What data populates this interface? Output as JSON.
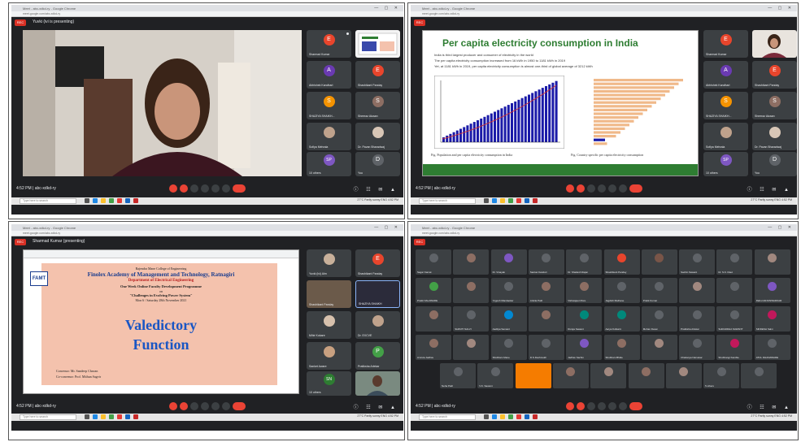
{
  "q1": {
    "browser_title": "Meet - abc-xdkd-ry - Google Chrome",
    "url": "meet.google.com/abc-xdkd-ry",
    "presenting_text": "Yuvki (ivi is presenting)",
    "time": "4:52 PM | abc-xdkd-ry",
    "participants": [
      {
        "label": "Sharmad Kumar",
        "initial": "E",
        "color": "#e8452c"
      },
      {
        "label": "",
        "initial": "",
        "color": ""
      },
      {
        "label": "Abhishek Kandhari",
        "initial": "A",
        "color": "#6a3ab2"
      },
      {
        "label": "Shashikant Panday",
        "initial": "E",
        "color": "#e8452c"
      },
      {
        "label": "SHAZIYA SHAIKH...",
        "initial": "S",
        "color": "#f59300"
      },
      {
        "label": "Sheeraz Aizaan",
        "initial": "S",
        "color": "#8d6e63"
      },
      {
        "label": "Sofiya Mehrala",
        "initial": "",
        "color": ""
      },
      {
        "label": "Dr. Pavan Bharadwaj",
        "initial": "",
        "color": ""
      },
      {
        "label": "10 others",
        "initial": "SP",
        "color": "#7e57c2"
      },
      {
        "label": "You",
        "initial": "D",
        "color": "#5f6368"
      }
    ]
  },
  "q2": {
    "browser_title": "Meet - abc-xdkd-ry - Google Chrome",
    "url": "meet.google.com/abc-xdkd-ry",
    "slide_title": "Per capita electricity consumption in India",
    "bullets": [
      "India is third largest producer and consumer of electricity in the world",
      "The per capita electricity consumption increased from 16 kWh in 1950 to 1181 kWh in 2019",
      "Yet, at 1181 kWh in 2019, per capita electricity consumption is almost one-third of global average of 3212 kWh"
    ],
    "caption_left": "Fig. Population and per capita electricity consumption in India",
    "caption_right": "Fig. Country specific per capita electricity consumption",
    "time": "4:52 PM | abc-xdkd-ry",
    "participants": [
      {
        "label": "Sharmad Kumar",
        "initial": "E",
        "color": "#e8452c"
      },
      {
        "label": "",
        "initial": "",
        "color": ""
      },
      {
        "label": "Abhishek Kandhari",
        "initial": "A",
        "color": "#6a3ab2"
      },
      {
        "label": "Shashikant Panday",
        "initial": "E",
        "color": "#e8452c"
      },
      {
        "label": "SHAZIYA SHAIKH...",
        "initial": "S",
        "color": "#f59300"
      },
      {
        "label": "Sheeraz Aizaan",
        "initial": "S",
        "color": "#8d6e63"
      },
      {
        "label": "Sofiya Mehrala",
        "initial": "",
        "color": ""
      },
      {
        "label": "Dr. Pavan Bharadwaj",
        "initial": "",
        "color": ""
      },
      {
        "label": "10 others",
        "initial": "SP",
        "color": "#7e57c2"
      },
      {
        "label": "You",
        "initial": "D",
        "color": "#5f6368"
      }
    ]
  },
  "q3": {
    "browser_title": "Meet - abc-xdkd-ry - Google Chrome",
    "url": "meet.google.com/abc-xdkd-ry",
    "presenting_text": "Sharmad Kumar (presenting)",
    "institute_line1": "Rajendra Mane College of Engineering",
    "institute_line2": "Finolex Academy of Management and Technology, Ratnagiri",
    "dept": "Department of Electrical Engineering",
    "program": "One Week Online Faculty Development Programme",
    "on": "on",
    "topic": "\"Challenges in Evolving Power System\"",
    "dates": "Mon 6 / Saturday 28th November 2021",
    "big1": "Valedictory",
    "big2": "Function",
    "foot1": "Convenor: Mr. Sandeep Chavan",
    "foot2": "Co-convenor: Prof. Mithun Sagvir",
    "logo": "FAMT",
    "time": "4:52 PM | abc-xdkd-ry",
    "participants": [
      {
        "label": "Yuvki (ivi) Alm",
        "initial": "",
        "color": ""
      },
      {
        "label": "Shashikant Panday",
        "initial": "E",
        "color": "#e8452c"
      },
      {
        "label": "Shashikant Panday",
        "initial": "",
        "color": ""
      },
      {
        "label": "SHAZIYA SHAIKH",
        "initial": "",
        "color": ""
      },
      {
        "label": "Mihir Kokare",
        "initial": "",
        "color": ""
      },
      {
        "label": "Dr. EXCVE",
        "initial": "",
        "color": ""
      },
      {
        "label": "Sanket Aware",
        "initial": "",
        "color": ""
      },
      {
        "label": "Pratiksha Arlekar",
        "initial": "P",
        "color": "#43a047"
      },
      {
        "label": "10 others",
        "initial": "SN",
        "color": "#2e7d32"
      },
      {
        "label": "",
        "initial": "",
        "color": ""
      }
    ]
  },
  "q4": {
    "browser_title": "Meet - abc-xdkd-ry - Google Chrome",
    "url": "meet.google.com/abc-xdkd-ry",
    "time": "4:52 PM | abc-xdkd-ry",
    "tiles": [
      {
        "label": "Sagar Kamat",
        "color": "#5f6368"
      },
      {
        "label": "",
        "color": "#8d6e63"
      },
      {
        "label": "Dr. Vinayak",
        "color": "#7e57c2"
      },
      {
        "label": "Sanket Kanduri",
        "color": "#5f6368"
      },
      {
        "label": "Dr. Shailesh Rajan",
        "color": "#5f6368"
      },
      {
        "label": "Shashikant Panday",
        "color": "#e8452c"
      },
      {
        "label": "",
        "color": "#795548"
      },
      {
        "label": "Sachin Sawant",
        "color": "#5f6368"
      },
      {
        "label": "Dr. S.K. Raut",
        "color": "#5f6368"
      },
      {
        "label": "",
        "color": "#a1887f"
      },
      {
        "label": "Pratik NALAWADE",
        "color": "#43a047"
      },
      {
        "label": "",
        "color": "#8d6e63"
      },
      {
        "label": "Yogesh Mandaokar",
        "color": "#5f6368"
      },
      {
        "label": "Ankita Patil",
        "color": "#8d6e63"
      },
      {
        "label": "Vishwajeet More",
        "color": "#8d6e63"
      },
      {
        "label": "Jagdish Mathane",
        "color": "#5f6368"
      },
      {
        "label": "Pratik Kumar",
        "color": "#5f6368"
      },
      {
        "label": "",
        "color": "#a1887f"
      },
      {
        "label": "",
        "color": "#5f6368"
      },
      {
        "label": "Rahul ARJUNWADKAR",
        "color": "#7e57c2"
      },
      {
        "label": "",
        "color": "#8d6e63"
      },
      {
        "label": "SHRUTI SALVI",
        "color": "#5f6368"
      },
      {
        "label": "Aaditya Samant",
        "color": "#0288d1"
      },
      {
        "label": "",
        "color": "#8d6e63"
      },
      {
        "label": "Rutuja Sawant",
        "color": "#00897b"
      },
      {
        "label": "Aarya Kulkarni",
        "color": "#00897b"
      },
      {
        "label": "Mohan Desai",
        "color": "#5f6368"
      },
      {
        "label": "Pratiksha Arlekar",
        "color": "#5f6368"
      },
      {
        "label": "SHRADDHA SAWANT",
        "color": "#5f6368"
      },
      {
        "label": "SIDDESH Salvi",
        "color": "#c2185b"
      },
      {
        "label": "Amruta Jadhav",
        "color": "#8d6e63"
      },
      {
        "label": "",
        "color": "#a1887f"
      },
      {
        "label": "Shubham Mane",
        "color": "#5f6368"
      },
      {
        "label": "D.S.Deshmukh",
        "color": "#5f6368"
      },
      {
        "label": "Jadhav Sachin",
        "color": "#7e57c2"
      },
      {
        "label": "Shubham Bhide",
        "color": "#8d6e63"
      },
      {
        "label": "",
        "color": "#a1887f"
      },
      {
        "label": "Chaitanya Narvekar",
        "color": "#5f6368"
      },
      {
        "label": "Shubhangi Kamble",
        "color": "#c2185b"
      },
      {
        "label": "ATUL DHANAWADE",
        "color": "#5f6368"
      },
      {
        "label": "Neha Patil",
        "color": "#5f6368"
      },
      {
        "label": "V.K. Sawant",
        "color": "#5f6368"
      },
      {
        "label": "",
        "color": "#f57c00"
      },
      {
        "label": "",
        "color": "#8d6e63"
      },
      {
        "label": "",
        "color": "#a1887f"
      },
      {
        "label": "",
        "color": "#8d6e63"
      },
      {
        "label": "",
        "color": "#a1887f"
      },
      {
        "label": "5 others",
        "color": "#5f6368"
      },
      {
        "label": "",
        "color": "#5f6368"
      }
    ]
  },
  "taskbar": {
    "search_placeholder": "Type here to search",
    "tray": "27°C Partly sunny  ENG  4:52 PM"
  },
  "icons": {
    "record": "record-icon",
    "mic": "mic-icon",
    "camera": "camera-icon",
    "captions": "captions-icon",
    "present": "present-icon",
    "hand": "raise-hand-icon",
    "more": "more-icon",
    "end": "end-call-icon"
  }
}
